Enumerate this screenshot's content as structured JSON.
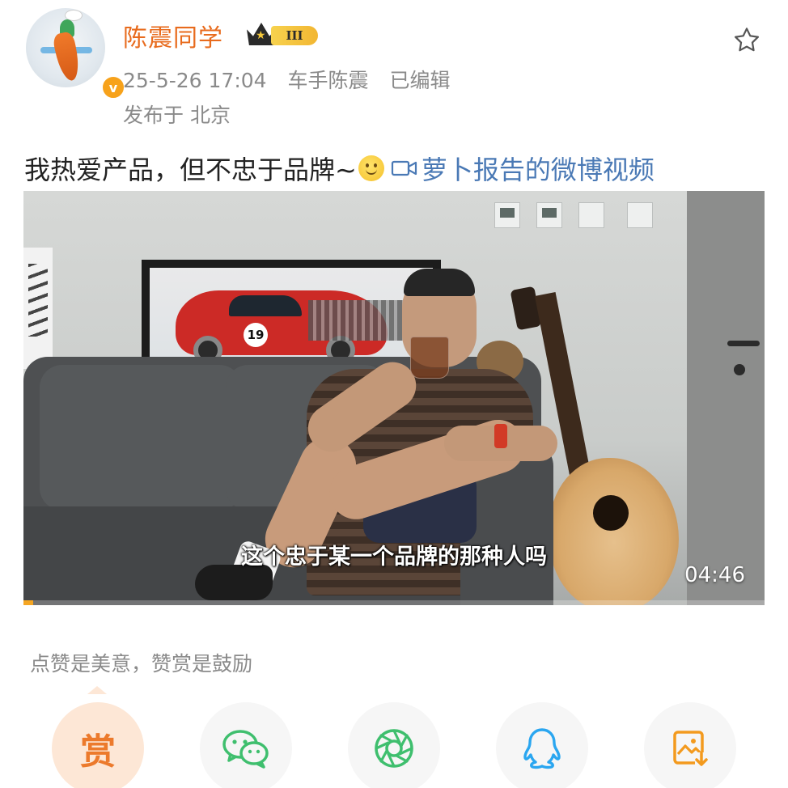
{
  "author": {
    "name": "陈震同学",
    "vip_level": "III",
    "verified_mark": "v",
    "post_time": "25-5-26 17:04",
    "source": "车手陈震",
    "edited": "已编辑",
    "location": "发布于 北京"
  },
  "post": {
    "text": "我热爱产品，但不忠于品牌~",
    "emoji": "smile-emoji",
    "video_link": "萝卜报告的微博视频"
  },
  "video": {
    "subtitle": "这个忠于某一个品牌的那种人吗",
    "duration": "04:46",
    "progress": 0.013,
    "car_number": "19"
  },
  "reward": {
    "hint": "点赞是美意，赞赏是鼓励",
    "reward_label": "赏"
  },
  "share_buttons": [
    {
      "name": "reward-button",
      "icon": "reward-icon"
    },
    {
      "name": "wechat-share-button",
      "icon": "wechat-icon"
    },
    {
      "name": "moments-share-button",
      "icon": "moments-icon"
    },
    {
      "name": "qq-share-button",
      "icon": "qq-icon"
    },
    {
      "name": "save-image-button",
      "icon": "save-image-icon"
    }
  ],
  "colors": {
    "username": "#e86b1d",
    "link": "#4a79b5",
    "meta": "#8a8a8a",
    "reward_accent": "#ec7a2c",
    "wechat_green": "#3fbf6e",
    "qq_blue": "#2aa6f0",
    "save_orange": "#f39a1e",
    "progress": "#f5a623"
  }
}
